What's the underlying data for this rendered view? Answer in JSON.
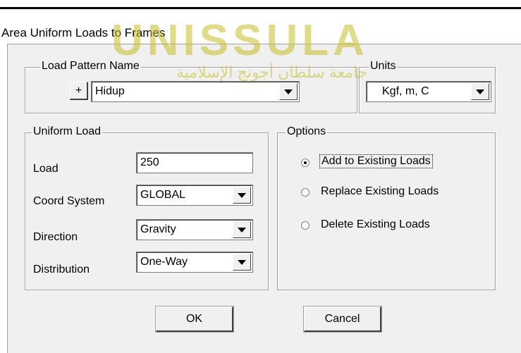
{
  "window": {
    "title": "Area Uniform Loads to Frames"
  },
  "load_pattern": {
    "legend": "Load Pattern Name",
    "add_button": "+",
    "selected": "Hidup"
  },
  "units": {
    "legend": "Units",
    "selected": "Kgf, m, C"
  },
  "uniform_load": {
    "legend": "Uniform Load",
    "load_label": "Load",
    "load_value": "250",
    "coord_label": "Coord System",
    "coord_value": "GLOBAL",
    "direction_label": "Direction",
    "direction_value": "Gravity",
    "distribution_label": "Distribution",
    "distribution_value": "One-Way"
  },
  "options": {
    "legend": "Options",
    "items": [
      {
        "label": "Add to Existing Loads",
        "selected": true
      },
      {
        "label": "Replace Existing Loads",
        "selected": false
      },
      {
        "label": "Delete Existing Loads",
        "selected": false
      }
    ]
  },
  "buttons": {
    "ok": "OK",
    "cancel": "Cancel"
  },
  "watermark": {
    "text": "UNISSULA",
    "arabic": "جامعة سلطان أجونج الإسلامية"
  },
  "colors": {
    "dialog_bg": "#f0f0f0",
    "watermark": "#c4be28"
  }
}
